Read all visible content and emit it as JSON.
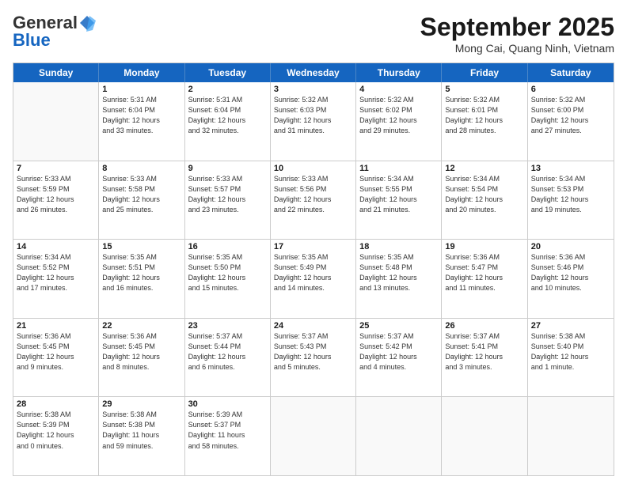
{
  "header": {
    "logo_general": "General",
    "logo_blue": "Blue",
    "month_title": "September 2025",
    "location": "Mong Cai, Quang Ninh, Vietnam"
  },
  "days": [
    "Sunday",
    "Monday",
    "Tuesday",
    "Wednesday",
    "Thursday",
    "Friday",
    "Saturday"
  ],
  "rows": [
    [
      {
        "day": "",
        "info": ""
      },
      {
        "day": "1",
        "info": "Sunrise: 5:31 AM\nSunset: 6:04 PM\nDaylight: 12 hours\nand 33 minutes."
      },
      {
        "day": "2",
        "info": "Sunrise: 5:31 AM\nSunset: 6:04 PM\nDaylight: 12 hours\nand 32 minutes."
      },
      {
        "day": "3",
        "info": "Sunrise: 5:32 AM\nSunset: 6:03 PM\nDaylight: 12 hours\nand 31 minutes."
      },
      {
        "day": "4",
        "info": "Sunrise: 5:32 AM\nSunset: 6:02 PM\nDaylight: 12 hours\nand 29 minutes."
      },
      {
        "day": "5",
        "info": "Sunrise: 5:32 AM\nSunset: 6:01 PM\nDaylight: 12 hours\nand 28 minutes."
      },
      {
        "day": "6",
        "info": "Sunrise: 5:32 AM\nSunset: 6:00 PM\nDaylight: 12 hours\nand 27 minutes."
      }
    ],
    [
      {
        "day": "7",
        "info": "Sunrise: 5:33 AM\nSunset: 5:59 PM\nDaylight: 12 hours\nand 26 minutes."
      },
      {
        "day": "8",
        "info": "Sunrise: 5:33 AM\nSunset: 5:58 PM\nDaylight: 12 hours\nand 25 minutes."
      },
      {
        "day": "9",
        "info": "Sunrise: 5:33 AM\nSunset: 5:57 PM\nDaylight: 12 hours\nand 23 minutes."
      },
      {
        "day": "10",
        "info": "Sunrise: 5:33 AM\nSunset: 5:56 PM\nDaylight: 12 hours\nand 22 minutes."
      },
      {
        "day": "11",
        "info": "Sunrise: 5:34 AM\nSunset: 5:55 PM\nDaylight: 12 hours\nand 21 minutes."
      },
      {
        "day": "12",
        "info": "Sunrise: 5:34 AM\nSunset: 5:54 PM\nDaylight: 12 hours\nand 20 minutes."
      },
      {
        "day": "13",
        "info": "Sunrise: 5:34 AM\nSunset: 5:53 PM\nDaylight: 12 hours\nand 19 minutes."
      }
    ],
    [
      {
        "day": "14",
        "info": "Sunrise: 5:34 AM\nSunset: 5:52 PM\nDaylight: 12 hours\nand 17 minutes."
      },
      {
        "day": "15",
        "info": "Sunrise: 5:35 AM\nSunset: 5:51 PM\nDaylight: 12 hours\nand 16 minutes."
      },
      {
        "day": "16",
        "info": "Sunrise: 5:35 AM\nSunset: 5:50 PM\nDaylight: 12 hours\nand 15 minutes."
      },
      {
        "day": "17",
        "info": "Sunrise: 5:35 AM\nSunset: 5:49 PM\nDaylight: 12 hours\nand 14 minutes."
      },
      {
        "day": "18",
        "info": "Sunrise: 5:35 AM\nSunset: 5:48 PM\nDaylight: 12 hours\nand 13 minutes."
      },
      {
        "day": "19",
        "info": "Sunrise: 5:36 AM\nSunset: 5:47 PM\nDaylight: 12 hours\nand 11 minutes."
      },
      {
        "day": "20",
        "info": "Sunrise: 5:36 AM\nSunset: 5:46 PM\nDaylight: 12 hours\nand 10 minutes."
      }
    ],
    [
      {
        "day": "21",
        "info": "Sunrise: 5:36 AM\nSunset: 5:45 PM\nDaylight: 12 hours\nand 9 minutes."
      },
      {
        "day": "22",
        "info": "Sunrise: 5:36 AM\nSunset: 5:45 PM\nDaylight: 12 hours\nand 8 minutes."
      },
      {
        "day": "23",
        "info": "Sunrise: 5:37 AM\nSunset: 5:44 PM\nDaylight: 12 hours\nand 6 minutes."
      },
      {
        "day": "24",
        "info": "Sunrise: 5:37 AM\nSunset: 5:43 PM\nDaylight: 12 hours\nand 5 minutes."
      },
      {
        "day": "25",
        "info": "Sunrise: 5:37 AM\nSunset: 5:42 PM\nDaylight: 12 hours\nand 4 minutes."
      },
      {
        "day": "26",
        "info": "Sunrise: 5:37 AM\nSunset: 5:41 PM\nDaylight: 12 hours\nand 3 minutes."
      },
      {
        "day": "27",
        "info": "Sunrise: 5:38 AM\nSunset: 5:40 PM\nDaylight: 12 hours\nand 1 minute."
      }
    ],
    [
      {
        "day": "28",
        "info": "Sunrise: 5:38 AM\nSunset: 5:39 PM\nDaylight: 12 hours\nand 0 minutes."
      },
      {
        "day": "29",
        "info": "Sunrise: 5:38 AM\nSunset: 5:38 PM\nDaylight: 11 hours\nand 59 minutes."
      },
      {
        "day": "30",
        "info": "Sunrise: 5:39 AM\nSunset: 5:37 PM\nDaylight: 11 hours\nand 58 minutes."
      },
      {
        "day": "",
        "info": ""
      },
      {
        "day": "",
        "info": ""
      },
      {
        "day": "",
        "info": ""
      },
      {
        "day": "",
        "info": ""
      }
    ]
  ]
}
